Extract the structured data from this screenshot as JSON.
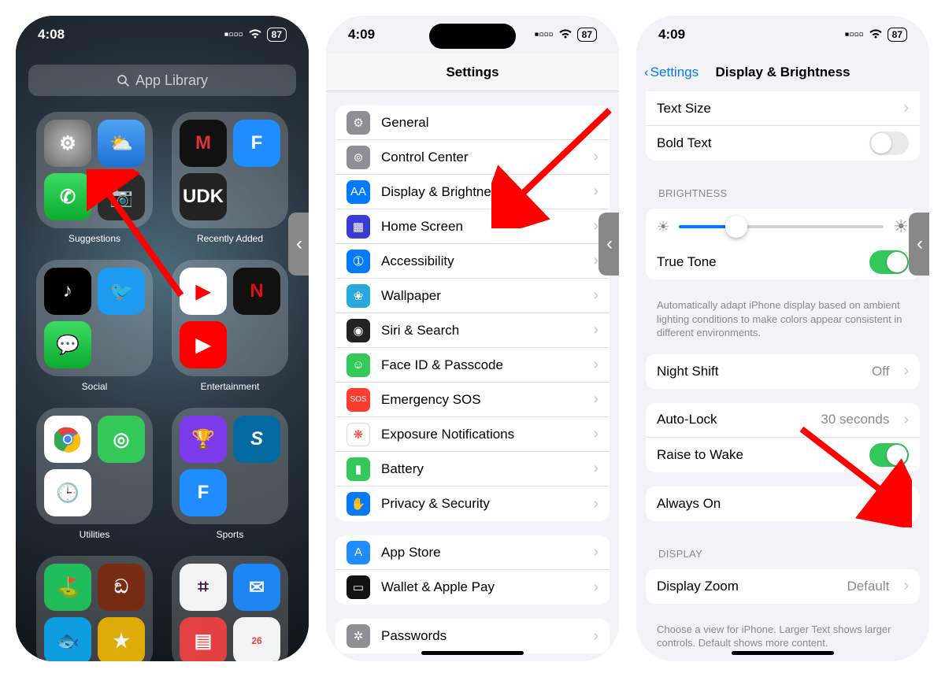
{
  "status": {
    "time1": "4:08",
    "time2": "4:09",
    "time3": "4:09",
    "battery": "87"
  },
  "phone1": {
    "search_placeholder": "App Library",
    "folders": [
      {
        "label": "Suggestions"
      },
      {
        "label": "Recently Added"
      },
      {
        "label": "Social"
      },
      {
        "label": "Entertainment"
      },
      {
        "label": "Utilities"
      },
      {
        "label": "Sports"
      }
    ]
  },
  "phone2": {
    "title": "Settings",
    "group1": [
      {
        "label": "General",
        "icon_bg": "#8e8e93",
        "glyph": "⚙"
      },
      {
        "label": "Control Center",
        "icon_bg": "#8e8e93",
        "glyph": "⊚"
      },
      {
        "label": "Display & Brightness",
        "icon_bg": "#007aff",
        "glyph": "AA"
      },
      {
        "label": "Home Screen",
        "icon_bg": "#3a3ad6",
        "glyph": "▦"
      },
      {
        "label": "Accessibility",
        "icon_bg": "#007aff",
        "glyph": "➀"
      },
      {
        "label": "Wallpaper",
        "icon_bg": "#29a7df",
        "glyph": "❀"
      },
      {
        "label": "Siri & Search",
        "icon_bg": "#222",
        "glyph": "◉"
      },
      {
        "label": "Face ID & Passcode",
        "icon_bg": "#34c759",
        "glyph": "☺"
      },
      {
        "label": "Emergency SOS",
        "icon_bg": "#ff3b30",
        "glyph": "SOS"
      },
      {
        "label": "Exposure Notifications",
        "icon_bg": "#fff",
        "glyph": "❋"
      },
      {
        "label": "Battery",
        "icon_bg": "#34c759",
        "glyph": "▮"
      },
      {
        "label": "Privacy & Security",
        "icon_bg": "#007aff",
        "glyph": "✋"
      }
    ],
    "group2": [
      {
        "label": "App Store",
        "icon_bg": "#1f8cff",
        "glyph": "A"
      },
      {
        "label": "Wallet & Apple Pay",
        "icon_bg": "#111",
        "glyph": "▭"
      }
    ],
    "group3": [
      {
        "label": "Passwords",
        "icon_bg": "#8e8e93",
        "glyph": "✲"
      }
    ]
  },
  "phone3": {
    "back": "Settings",
    "title": "Display & Brightness",
    "text_size": "Text Size",
    "bold_text": "Bold Text",
    "brightness_header": "BRIGHTNESS",
    "brightness_pct": 28,
    "true_tone": "True Tone",
    "true_tone_note": "Automatically adapt iPhone display based on ambient lighting conditions to make colors appear consistent in different environments.",
    "night_shift": "Night Shift",
    "night_shift_val": "Off",
    "auto_lock": "Auto-Lock",
    "auto_lock_val": "30 seconds",
    "raise_to_wake": "Raise to Wake",
    "always_on": "Always On",
    "display_header": "DISPLAY",
    "display_zoom": "Display Zoom",
    "display_zoom_val": "Default",
    "display_zoom_note": "Choose a view for iPhone. Larger Text shows larger controls. Default shows more content."
  }
}
